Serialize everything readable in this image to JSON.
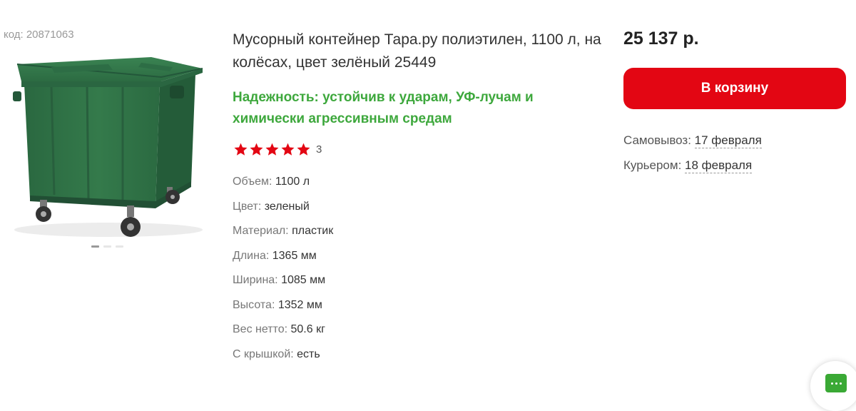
{
  "product": {
    "code": "код: 20871063",
    "title": "Мусорный контейнер Тара.ру полиэтилен, 1100 л, на колёсах, цвет зелёный 25449",
    "feature": "Надежность: устойчив к ударам, УФ-лучам и химически агрессивным средам",
    "image_icon": "green-garbage-container-image",
    "gallery": {
      "total": 3,
      "active_index": 0
    },
    "rating": {
      "stars": 5,
      "max": 5,
      "count": "3"
    }
  },
  "specs": [
    {
      "label": "Объем:",
      "value": "1100 л"
    },
    {
      "label": "Цвет:",
      "value": "зеленый"
    },
    {
      "label": "Материал:",
      "value": "пластик"
    },
    {
      "label": "Длина:",
      "value": "1365 мм"
    },
    {
      "label": "Ширина:",
      "value": "1085 мм"
    },
    {
      "label": "Высота:",
      "value": "1352 мм"
    },
    {
      "label": "Вес нетто:",
      "value": "50.6 кг"
    },
    {
      "label": "С крышкой:",
      "value": "есть"
    }
  ],
  "purchase": {
    "price": "25 137 р.",
    "cart_button": "В корзину",
    "pickup_label": "Самовывоз:",
    "pickup_date": "17 февраля",
    "courier_label": "Курьером:",
    "courier_date": "18 февраля"
  },
  "chat": {
    "icon": "chat-bubble-icon"
  },
  "colors": {
    "accent_red": "#e30613",
    "feature_green": "#3ea83d",
    "star_red": "#e30613",
    "container_green": "#2f6f45",
    "chat_green": "#3aa935"
  }
}
